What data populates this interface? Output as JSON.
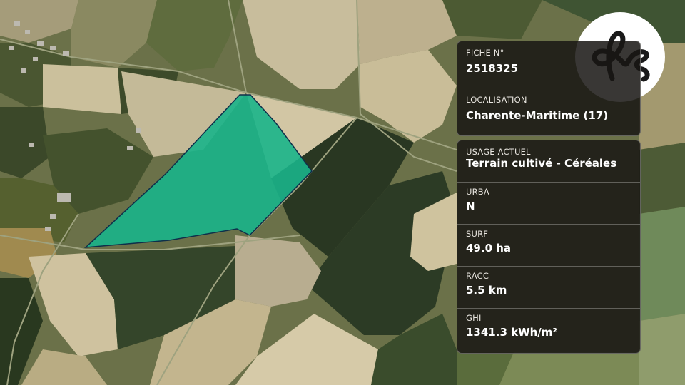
{
  "colors": {
    "parcel_fill": "#19b48a",
    "parcel_stroke": "#0e2f4a",
    "panel_bg": "#181614",
    "logo_bg": "#ffffff",
    "logo_ink": "#1a1a1a"
  },
  "logo": {
    "icon": "fs-logo-icon",
    "text": "fs"
  },
  "info": {
    "fiche": {
      "label": "FICHE N°",
      "value": "2518325"
    },
    "localisation": {
      "label": "LOCALISATION",
      "value": "Charente-Maritime (17)"
    },
    "usage": {
      "label": "USAGE ACTUEL",
      "value": "Terrain cultivé - Céréales"
    },
    "urba": {
      "label": "URBA",
      "value": "N"
    },
    "surf": {
      "label": "SURF",
      "value": "49.0 ha"
    },
    "racc": {
      "label": "RACC",
      "value": "5.5 km"
    },
    "ghi": {
      "label": "GHI",
      "value": "1341.3 kWh/m²"
    }
  }
}
